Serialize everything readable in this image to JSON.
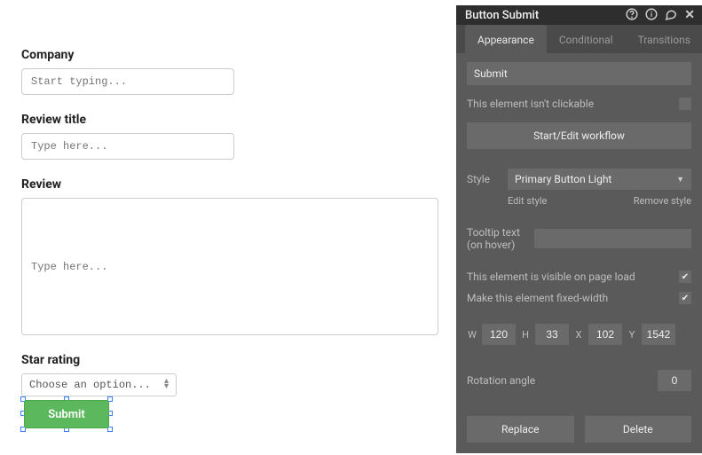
{
  "form": {
    "company_label": "Company",
    "company_placeholder": "Start typing...",
    "review_title_label": "Review title",
    "review_title_placeholder": "Type here...",
    "review_label": "Review",
    "review_placeholder": "Type here...",
    "star_rating_label": "Star rating",
    "star_rating_placeholder": "Choose an option...",
    "submit_label": "Submit"
  },
  "panel": {
    "title": "Button Submit",
    "tabs": {
      "appearance": "Appearance",
      "conditional": "Conditional",
      "transitions": "Transitions"
    },
    "value": "Submit",
    "clickable_text": "This element isn't clickable",
    "start_edit_workflow": "Start/Edit workflow",
    "style_label": "Style",
    "style_value": "Primary Button Light",
    "edit_style": "Edit style",
    "remove_style": "Remove style",
    "tooltip_label": "Tooltip text (on hover)",
    "visible_label": "This element is visible on page load",
    "fixed_width_label": "Make this element fixed-width",
    "visible_checked": true,
    "fixed_width_checked": true,
    "dims": {
      "w_label": "W",
      "w": "120",
      "h_label": "H",
      "h": "33",
      "x_label": "X",
      "x": "102",
      "y_label": "Y",
      "y": "1542"
    },
    "rotation_label": "Rotation angle",
    "rotation_value": "0",
    "replace": "Replace",
    "delete": "Delete"
  }
}
